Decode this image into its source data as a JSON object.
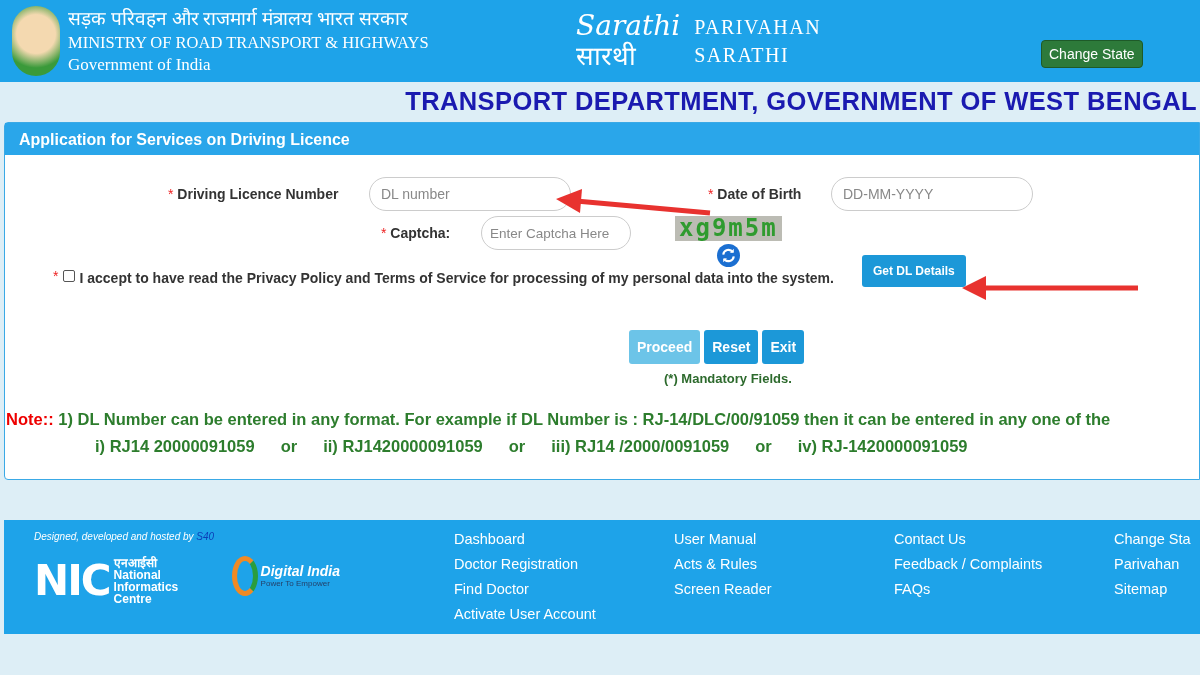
{
  "header": {
    "ministry_hindi": "सड़क परिवहन और राजमार्ग मंत्रालय भारत सरकार",
    "ministry": "MINISTRY OF ROAD TRANSPORT & HIGHWAYS",
    "government": "Government of India",
    "logo_script": "Sarathi",
    "logo_hindi": "सारथी",
    "brand_line1": "PARIVAHAN",
    "brand_line2": "SARATHI",
    "change_state": "Change State"
  },
  "department": "TRANSPORT DEPARTMENT, GOVERNMENT OF WEST BENGAL",
  "panel": {
    "title": "Application for Services on Driving Licence",
    "required_mark": "*",
    "dl_label": "Driving Licence Number",
    "dl_placeholder": "DL number",
    "dob_label": "Date of Birth",
    "dob_placeholder": "DD-MM-YYYY",
    "captcha_label": "Captcha:",
    "captcha_placeholder": "Enter Captcha Here",
    "captcha_text": "xg9m5m",
    "consent": {
      "checked": false,
      "text": "I accept to have read the **Privacy Policy** and **Terms of Service** for processing of my personal data into the system."
    },
    "get_details": "Get DL Details",
    "buttons": [
      {
        "label": "Proceed",
        "disabled": true
      },
      {
        "label": "Reset",
        "disabled": false
      },
      {
        "label": "Exit",
        "disabled": false
      }
    ],
    "mandatory": "(*) Mandatory Fields.",
    "note_label": "Note::",
    "note_text": "1) DL Number can be entered in any format. For example if DL Number is : RJ-14/DLC/00/91059 then it can be entered in any one of the",
    "examples": [
      "i) RJ14 20000091059",
      "or",
      "ii) RJ1420000091059",
      "or",
      "iii) RJ14 /2000/0091059",
      "or",
      "iv) RJ-1420000091059"
    ]
  },
  "footer": {
    "credit": "Designed, developed and hosted by",
    "credit_logo": "S40",
    "nic_letters": "NIC",
    "nic_hindi": "एनआईसी",
    "nic_name": "National Informatics Centre",
    "di_name": "Digital India",
    "di_tagline": "Power To Empower",
    "columns": [
      [
        "Dashboard",
        "Doctor Registration",
        "Find Doctor",
        "Activate User Account"
      ],
      [
        "User Manual",
        "Acts & Rules",
        "Screen Reader"
      ],
      [
        "Contact Us",
        "Feedback / Complaints",
        "FAQs"
      ],
      [
        "Change Sta",
        "Parivahan",
        "Sitemap"
      ]
    ]
  }
}
